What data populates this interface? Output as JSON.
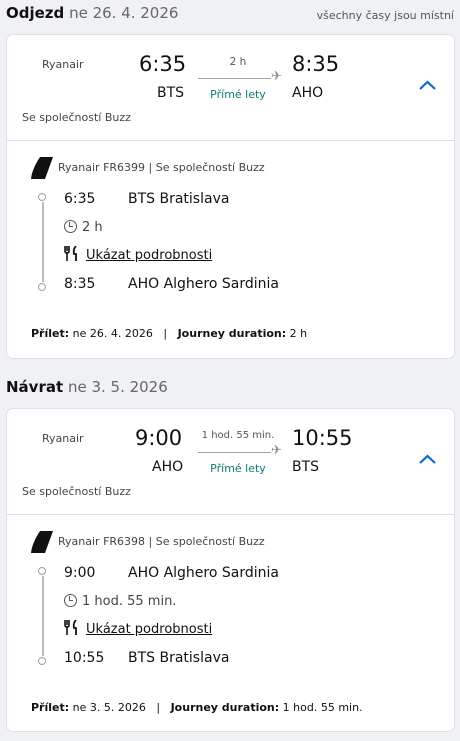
{
  "timezone_note": "všechny časy jsou místní",
  "outbound": {
    "heading": "Odjezd",
    "date": "ne 26. 4. 2026",
    "airline": "Ryanair",
    "dep_time": "6:35",
    "arr_time": "8:35",
    "dep_code": "BTS",
    "arr_code": "AHO",
    "duration": "2 h",
    "direct": "Přímé lety",
    "operated_by": "Se společností Buzz",
    "flight_number": "Ryanair FR6399 | Se společností Buzz",
    "stop1_time": "6:35",
    "stop1_place": "BTS Bratislava",
    "leg_duration": "2 h",
    "meal_link": "Ukázat podrobnosti",
    "stop2_time": "8:35",
    "stop2_place": "AHO Alghero Sardinia",
    "arrival_label": "Přílet:",
    "arrival_date": "ne 26. 4. 2026",
    "sep": "|",
    "journey_label": "Journey duration:",
    "journey_value": "2 h"
  },
  "return": {
    "heading": "Návrat",
    "date": "ne 3. 5. 2026",
    "airline": "Ryanair",
    "dep_time": "9:00",
    "arr_time": "10:55",
    "dep_code": "AHO",
    "arr_code": "BTS",
    "duration": "1 hod. 55 min.",
    "direct": "Přímé lety",
    "operated_by": "Se společností Buzz",
    "flight_number": "Ryanair FR6398 | Se společností Buzz",
    "stop1_time": "9:00",
    "stop1_place": "AHO Alghero Sardinia",
    "leg_duration": "1 hod. 55 min.",
    "meal_link": "Ukázat podrobnosti",
    "stop2_time": "10:55",
    "stop2_place": "BTS Bratislava",
    "arrival_label": "Přílet:",
    "arrival_date": "ne 3. 5. 2026",
    "sep": "|",
    "journey_label": "Journey duration:",
    "journey_value": "1 hod. 55 min."
  },
  "colors": {
    "accent": "#0b6bcb",
    "direct": "#0b7b73"
  }
}
